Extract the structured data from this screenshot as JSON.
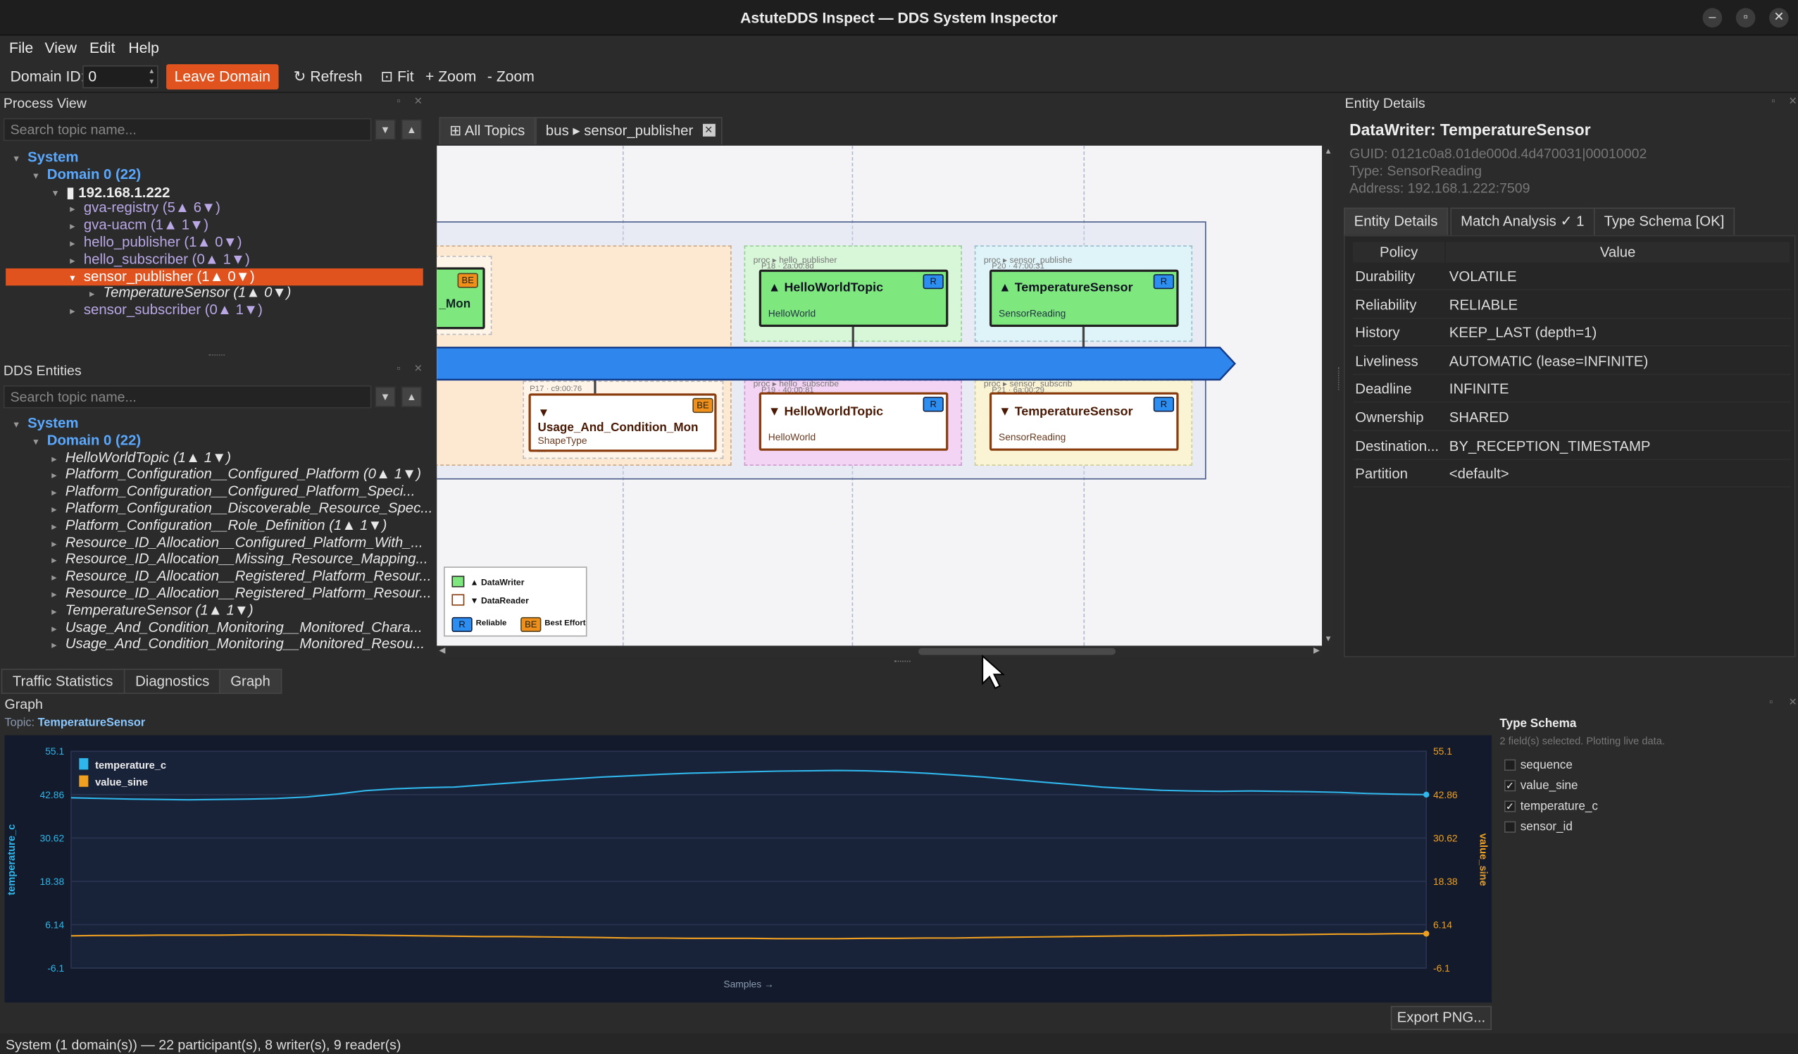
{
  "window": {
    "title": "AstuteDDS Inspect — DDS System Inspector",
    "controls": [
      "–",
      "▫",
      "✕"
    ]
  },
  "menu": [
    "File",
    "View",
    "Edit",
    "Help"
  ],
  "toolbar": {
    "domain_label": "Domain ID:",
    "domain_value": "0",
    "leave": "Leave Domain",
    "refresh": "↻ Refresh",
    "fit": "⊡ Fit",
    "zoom_in": "+ Zoom",
    "zoom_out": "- Zoom"
  },
  "process_view": {
    "title": "Process View",
    "search_placeholder": "Search topic name...",
    "tree": [
      {
        "label": "System",
        "depth": 0,
        "style": "blue",
        "exp": "▾"
      },
      {
        "label": "Domain 0  (22)",
        "depth": 1,
        "style": "blue",
        "exp": "▾"
      },
      {
        "label": "▮ 192.168.1.222",
        "depth": 2,
        "style": "white",
        "exp": "▾"
      },
      {
        "label": "gva-registry  (5▲ 6▼)",
        "depth": 3,
        "style": "purple",
        "exp": "▸"
      },
      {
        "label": "gva-uacm  (1▲ 1▼)",
        "depth": 3,
        "style": "purple",
        "exp": "▸"
      },
      {
        "label": "hello_publisher  (1▲ 0▼)",
        "depth": 3,
        "style": "purple",
        "exp": "▸"
      },
      {
        "label": "hello_subscriber  (0▲ 1▼)",
        "depth": 3,
        "style": "purple",
        "exp": "▸"
      },
      {
        "label": "sensor_publisher  (1▲ 0▼)",
        "depth": 3,
        "style": "selected",
        "exp": "▾"
      },
      {
        "label": "TemperatureSensor  (1▲ 0▼)",
        "depth": 4,
        "style": "italic",
        "exp": "▸"
      },
      {
        "label": "sensor_subscriber  (0▲ 1▼)",
        "depth": 3,
        "style": "purple",
        "exp": "▸"
      }
    ]
  },
  "dds_entities": {
    "title": "DDS Entities",
    "search_placeholder": "Search topic name...",
    "tree": [
      {
        "label": "System",
        "depth": 0,
        "style": "blue",
        "exp": "▾"
      },
      {
        "label": "Domain 0  (22)",
        "depth": 1,
        "style": "blue",
        "exp": "▾"
      },
      {
        "label": "HelloWorldTopic  (1▲ 1▼)",
        "depth": 2,
        "style": "italic",
        "exp": "▸"
      },
      {
        "label": "Platform_Configuration__Configured_Platform  (0▲ 1▼)",
        "depth": 2,
        "style": "italic",
        "exp": "▸"
      },
      {
        "label": "Platform_Configuration__Configured_Platform_Speci...",
        "depth": 2,
        "style": "italic",
        "exp": "▸"
      },
      {
        "label": "Platform_Configuration__Discoverable_Resource_Spec...",
        "depth": 2,
        "style": "italic",
        "exp": "▸"
      },
      {
        "label": "Platform_Configuration__Role_Definition  (1▲ 1▼)",
        "depth": 2,
        "style": "italic",
        "exp": "▸"
      },
      {
        "label": "Resource_ID_Allocation__Configured_Platform_With_...",
        "depth": 2,
        "style": "italic",
        "exp": "▸"
      },
      {
        "label": "Resource_ID_Allocation__Missing_Resource_Mapping...",
        "depth": 2,
        "style": "italic",
        "exp": "▸"
      },
      {
        "label": "Resource_ID_Allocation__Registered_Platform_Resour...",
        "depth": 2,
        "style": "italic",
        "exp": "▸"
      },
      {
        "label": "Resource_ID_Allocation__Registered_Platform_Resour...",
        "depth": 2,
        "style": "italic",
        "exp": "▸"
      },
      {
        "label": "TemperatureSensor  (1▲ 1▼)",
        "depth": 2,
        "style": "italic",
        "exp": "▸"
      },
      {
        "label": "Usage_And_Condition_Monitoring__Monitored_Chara...",
        "depth": 2,
        "style": "italic",
        "exp": "▸"
      },
      {
        "label": "Usage_And_Condition_Monitoring__Monitored_Resou...",
        "depth": 2,
        "style": "italic",
        "exp": "▸"
      }
    ]
  },
  "topic_tabs": [
    "⊞ All Topics",
    "bus ▸ sensor_publisher"
  ],
  "diagram": {
    "left_partial_label": "_Mon",
    "bottom_left_proc": "P17 · c9:00:76",
    "bottom_left_name": "Usage_And_Condition_Mon",
    "bottom_left_type": "ShapeType",
    "bottom_left_more": "...",
    "hello_pub_proc": "proc ▸ hello_publisher",
    "hello_pub_pid": "P18 · 2a:00:8d",
    "hello_pub_name": "▲ HelloWorldTopic",
    "hello_pub_type": "HelloWorld",
    "sensor_pub_proc": "proc ▸ sensor_publishe",
    "sensor_pub_pid": "P20 · 47:00:31",
    "sensor_pub_name": "▲ TemperatureSensor",
    "sensor_pub_type": "SensorReading",
    "hello_sub_proc": "proc ▸ hello_subscribe",
    "hello_sub_pid": "P19 · 40:00:81",
    "hello_sub_name": "▼ HelloWorldTopic",
    "hello_sub_type": "HelloWorld",
    "sensor_sub_proc": "proc ▸ sensor_subscrib",
    "sensor_sub_pid": "P21 · 6a:00:29",
    "sensor_sub_name": "▼ TemperatureSensor",
    "sensor_sub_type": "SensorReading",
    "badge_r": "R",
    "badge_be": "BE",
    "bl_arrow": "▼",
    "legend": {
      "writer": "▲ DataWriter",
      "reader": "▼ DataReader",
      "reliable": "Reliable",
      "best_effort": "Best Effort"
    }
  },
  "entity_details": {
    "panel_title": "Entity Details",
    "heading": "DataWriter: TemperatureSensor",
    "guid": "GUID: 0121c0a8.01de000d.4d470031|00010002",
    "type": "Type: SensorReading",
    "address": "Address: 192.168.1.222:7509",
    "tabs": [
      "Entity Details",
      "Match Analysis ✓ 1",
      "Type Schema [OK]"
    ],
    "col_policy": "Policy",
    "col_value": "Value",
    "rows": [
      {
        "policy": "Durability",
        "value": "VOLATILE"
      },
      {
        "policy": "Reliability",
        "value": "RELIABLE"
      },
      {
        "policy": "History",
        "value": "KEEP_LAST (depth=1)"
      },
      {
        "policy": "Liveliness",
        "value": "AUTOMATIC (lease=INFINITE)"
      },
      {
        "policy": "Deadline",
        "value": "INFINITE"
      },
      {
        "policy": "Ownership",
        "value": "SHARED"
      },
      {
        "policy": "Destination...",
        "value": "BY_RECEPTION_TIMESTAMP"
      },
      {
        "policy": "Partition",
        "value": "<default>"
      }
    ]
  },
  "bottom_tabs": [
    "Traffic Statistics",
    "Diagnostics",
    "Graph"
  ],
  "graph": {
    "panel_title": "Graph",
    "topic_label": "Topic:",
    "topic_value": "TemperatureSensor",
    "export": "Export PNG...",
    "schema_title": "Type Schema",
    "schema_info": "2 field(s) selected. Plotting live data.",
    "fields": [
      {
        "name": "sequence",
        "checked": false
      },
      {
        "name": "value_sine",
        "checked": true
      },
      {
        "name": "temperature_c",
        "checked": true
      },
      {
        "name": "sensor_id",
        "checked": false
      }
    ]
  },
  "colors": {
    "accent": "#e0531f",
    "temperature": "#2fb6ea",
    "sine": "#f0a020",
    "writer": "#7af07a",
    "reliable": "#2b8ef0"
  },
  "chart_data": {
    "type": "line",
    "xlabel": "Samples →",
    "ylabel_left": "temperature_c",
    "ylabel_right": "value_sine",
    "ylim": [
      -6.1,
      55.1
    ],
    "ticks": [
      55.1,
      42.86,
      30.62,
      18.38,
      6.14,
      -6.1
    ],
    "tick_labels": [
      "55.1",
      "42.86",
      "30.62",
      "18.38",
      "6.14",
      "-6.1"
    ],
    "legend_placement": "top-left",
    "series": [
      {
        "name": "temperature_c",
        "color": "#2fb6ea",
        "values": [
          42.0,
          41.8,
          41.6,
          41.5,
          41.4,
          41.5,
          41.6,
          41.8,
          42.2,
          43.0,
          44.0,
          44.5,
          44.8,
          45.0,
          45.6,
          46.2,
          46.8,
          47.3,
          47.8,
          48.2,
          48.6,
          48.9,
          49.1,
          49.3,
          49.5,
          49.6,
          49.7,
          49.6,
          49.3,
          48.9,
          48.4,
          47.8,
          47.1,
          46.4,
          45.7,
          45.0,
          44.5,
          44.1,
          43.9,
          43.8,
          43.9,
          43.8,
          43.7,
          43.5,
          43.2,
          43.0,
          42.86
        ]
      },
      {
        "name": "value_sine",
        "color": "#f0a020",
        "values": [
          3.0,
          3.1,
          3.1,
          3.2,
          3.2,
          3.2,
          3.3,
          3.3,
          3.3,
          3.3,
          3.2,
          3.1,
          3.0,
          2.9,
          2.8,
          2.8,
          2.7,
          2.6,
          2.5,
          2.4,
          2.4,
          2.3,
          2.3,
          2.3,
          2.2,
          2.2,
          2.2,
          2.3,
          2.3,
          2.4,
          2.4,
          2.5,
          2.6,
          2.7,
          2.8,
          2.9,
          3.0,
          3.0,
          3.1,
          3.2,
          3.3,
          3.3,
          3.4,
          3.5,
          3.5,
          3.6,
          3.6
        ]
      }
    ]
  },
  "status": "System (1 domain(s)) — 22 participant(s), 8 writer(s), 9 reader(s)"
}
